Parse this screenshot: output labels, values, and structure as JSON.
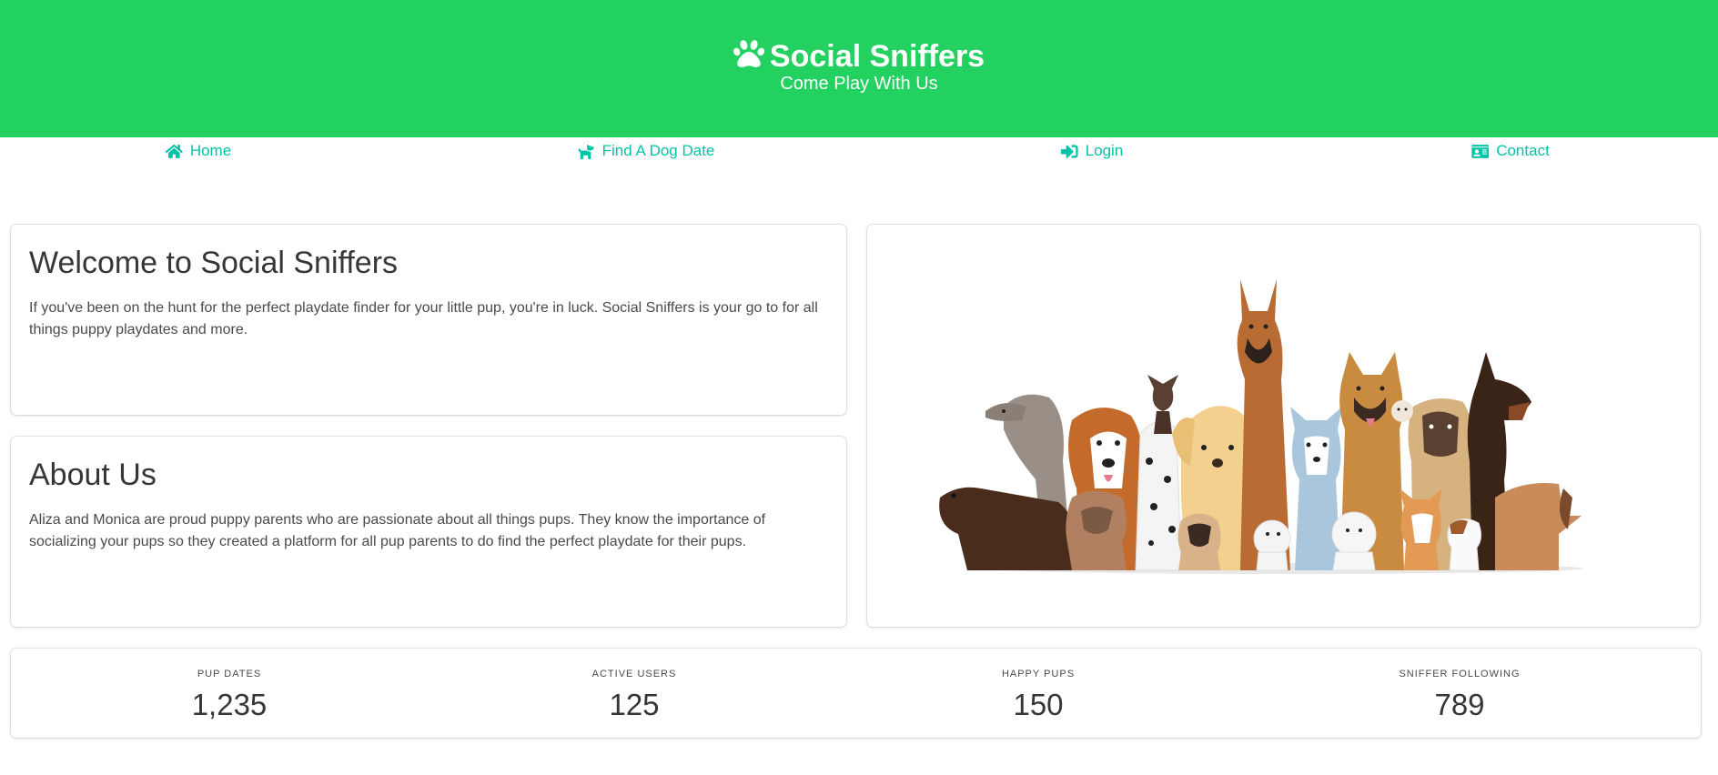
{
  "hero": {
    "title": "Social Sniffers",
    "subtitle": "Come Play With Us",
    "icon": "paw-icon",
    "background_color": "#23d160"
  },
  "nav": {
    "link_color": "#00c4a7",
    "items": [
      {
        "label": "Home",
        "icon": "home-icon"
      },
      {
        "label": "Find A Dog Date",
        "icon": "dog-icon"
      },
      {
        "label": "Login",
        "icon": "sign-in-icon"
      },
      {
        "label": "Contact",
        "icon": "id-card-icon"
      }
    ]
  },
  "welcome": {
    "title": "Welcome to Social Sniffers",
    "body": "If you've been on the hunt for the perfect playdate finder for your little pup, you're in luck. Social Sniffers is your go to for all things puppy playdates and more."
  },
  "about": {
    "title": "About Us",
    "body": "Aliza and Monica are proud puppy parents who are passionate about all things pups. They know the importance of socializing your pups so they created a platform for all pup parents to do find the perfect playdate for their pups."
  },
  "hero_image": {
    "description": "illustration-group-of-dogs"
  },
  "stats": [
    {
      "heading": "Pup Dates",
      "value": "1,235"
    },
    {
      "heading": "Active Users",
      "value": "125"
    },
    {
      "heading": "Happy Pups",
      "value": "150"
    },
    {
      "heading": "Sniffer Following",
      "value": "789"
    }
  ]
}
